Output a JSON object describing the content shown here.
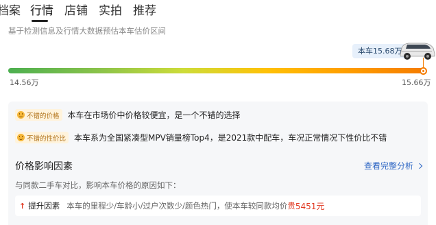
{
  "tabs": [
    {
      "label": "档案"
    },
    {
      "label": "行情"
    },
    {
      "label": "店铺"
    },
    {
      "label": "实拍"
    },
    {
      "label": "推荐"
    }
  ],
  "active_tab": "行情",
  "subtitle": "基于检测信息及行情大数据预估本车估价区间",
  "estimate": {
    "car_label": "本车15.68万",
    "min_label": "14.56万",
    "max_label": "15.66万",
    "position_fraction": 1.0
  },
  "highlights": [
    {
      "tag": "不错的价格",
      "text": "本车在市场价中价格较便宜，是一个不错的选择"
    },
    {
      "tag": "不错的性价比",
      "text": "本车系为全国紧凑型MPV销量榜Top4，是2021款中配车，车况正常情况下性价比不错"
    }
  ],
  "factors": {
    "title": "价格影响因素",
    "see_all": "查看完整分析",
    "description": "与同款二手车对比，影响本车价格的原因如下：",
    "items": [
      {
        "label": "提升因素",
        "text": "本车的里程少/车龄小/过户次数少/颜色热门，使本车较同款均价",
        "price_word": "贵",
        "amount": "5451元"
      }
    ]
  },
  "colors": {
    "accent_blue": "#2d66c4",
    "price_red": "#e0371f",
    "bar_start": "#4caf50",
    "bar_end": "#f57c00"
  }
}
